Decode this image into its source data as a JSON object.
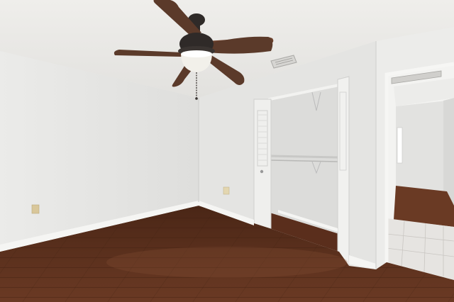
{
  "scene": {
    "description_kind": "photo",
    "elements": {
      "ceiling_fan": {
        "blade_count": 5,
        "light_kit": true,
        "pull_chain": true
      },
      "closet": {
        "doors": "bifold-louvered",
        "rod": true,
        "shelf": true,
        "open": true
      },
      "doorway": {
        "leads_to": "hallway",
        "hallway_floor": [
          "tile",
          "wood"
        ]
      },
      "outlets": 2,
      "ceiling_vent": true,
      "floor": "dark-wood-laminate",
      "ceiling": "textured"
    },
    "colors": {
      "wall": "#e6e6e4",
      "wall_shadow": "#dcdcda",
      "ceiling": "#ecebe8",
      "floor": "#5a3120",
      "floor_light": "#6e3d27",
      "fan_blade": "#5b3a2a",
      "fan_metal": "#2f2a28",
      "baseboard": "#f4f4f2",
      "tile": "#e4e2df"
    }
  }
}
